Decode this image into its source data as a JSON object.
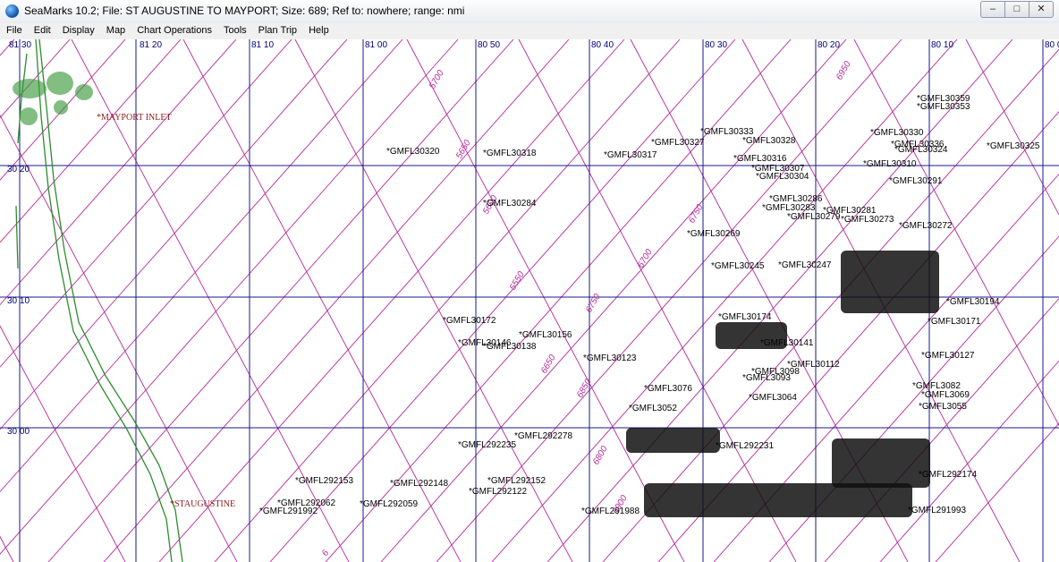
{
  "window": {
    "title": "SeaMarks  10.2;  File: ST AUGUSTINE TO MAYPORT;  Size:  689;   Ref to: nowhere;   range: nmi",
    "buttons": {
      "minimize": "‒",
      "maximize": "□",
      "close": "✕"
    }
  },
  "menu": [
    "File",
    "Edit",
    "Display",
    "Map",
    "Chart Operations",
    "Tools",
    "Plan Trip",
    "Help"
  ],
  "colors": {
    "grid": "#1a1a8c",
    "loran": "#b3289a",
    "coast": "#2e8b2e",
    "city": "#8b1a1a"
  },
  "grid_labels": {
    "longitude": [
      "81 30",
      "81 20",
      "81 10",
      "81 00",
      "80 50",
      "80 40",
      "80 30",
      "80 20",
      "80 10",
      "80 0"
    ],
    "latitude": [
      "30 20",
      "30 10",
      "30 00"
    ]
  },
  "places": [
    "*MAYPORT INLET",
    "*STAUGUSTINE"
  ],
  "loran_labels": [
    "5700",
    "5650",
    "5600",
    "5550",
    "6750",
    "6700",
    "6650",
    "6800",
    "6850",
    "6900",
    "6950",
    "6750",
    "6"
  ],
  "waypoints": [
    "GMFL30320",
    "GMFL30318",
    "GMFL30284",
    "GMFL30317",
    "GMFL30327",
    "GMFL30325",
    "GMFL30353",
    "GMFL30359",
    "GMFL30330",
    "GMFL30336",
    "GMFL30324",
    "GMFL30310",
    "GMFL30291",
    "GMFL30272",
    "GMFL30281",
    "GMFL30273",
    "GMFL30269",
    "GMFL30245",
    "GMFL30247",
    "GMFL30194",
    "GMFL30172",
    "GMFL30171",
    "GMFL30174",
    "GMFL30156",
    "GMFL30146",
    "GMFL30138",
    "GMFL30141",
    "GMFL30127",
    "GMFL30123",
    "GMFL30112",
    "GMFL3098",
    "GMFL3093",
    "GMFL3082",
    "GMFL3076",
    "GMFL3069",
    "GMFL3064",
    "GMFL3055",
    "GMFL3052",
    "GMFL292278",
    "GMFL292235",
    "GMFL292231",
    "GMFL292174",
    "GMFL292153",
    "GMFL292148",
    "GMFL292152",
    "GMFL292122",
    "GMFL292062",
    "GMFL292059",
    "GMFL291992",
    "GMFL291988",
    "GMFL291993",
    "GMFL30307",
    "GMFL30304",
    "GMFL30286",
    "GMFL30283",
    "GMFL30279",
    "GMFL30316",
    "GMFL30328",
    "GMFL30333"
  ]
}
